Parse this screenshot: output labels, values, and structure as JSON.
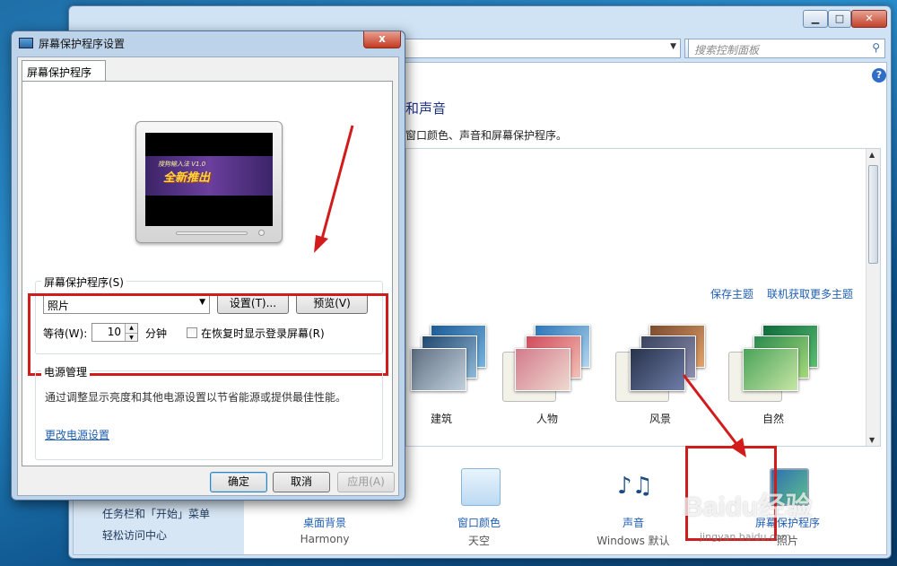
{
  "control_panel": {
    "search_placeholder": "搜索控制面板",
    "heading": "和声音",
    "description": "窗口颜色、声音和屏幕保护程序。",
    "save_theme": "保存主题",
    "more_themes": "联机获取更多主题",
    "themes": [
      {
        "label": "建筑"
      },
      {
        "label": "人物"
      },
      {
        "label": "风景"
      },
      {
        "label": "自然"
      }
    ],
    "left_nav": [
      "任务栏和「开始」菜单",
      "轻松访问中心"
    ],
    "bottom_items": [
      {
        "title": "桌面背景",
        "value": "Harmony"
      },
      {
        "title": "窗口颜色",
        "value": "天空"
      },
      {
        "title": "声音",
        "value": "Windows 默认"
      },
      {
        "title": "屏幕保护程序",
        "value": "照片"
      }
    ]
  },
  "dialog": {
    "title": "屏幕保护程序设置",
    "close": "x",
    "tab": "屏幕保护程序",
    "promo_line1": "搜狗输入法 V1.0",
    "promo_line2": "全新推出",
    "saver_group": "屏幕保护程序(S)",
    "saver_selected": "照片",
    "settings_button": "设置(T)...",
    "preview_button": "预览(V)",
    "wait_label": "等待(W):",
    "wait_value": "10",
    "minutes_label": "分钟",
    "resume_label": "在恢复时显示登录屏幕(R)",
    "resume_checked": false,
    "power_group": "电源管理",
    "power_description": "通过调整显示亮度和其他电源设置以节省能源或提供最佳性能。",
    "power_link": "更改电源设置",
    "ok": "确定",
    "cancel": "取消",
    "apply": "应用(A)"
  },
  "watermark": {
    "text": "Baidu经验",
    "url": "jingyan.baidu.com"
  },
  "colors": {
    "highlight": "#d21b1b",
    "link": "#1f5fb3"
  }
}
